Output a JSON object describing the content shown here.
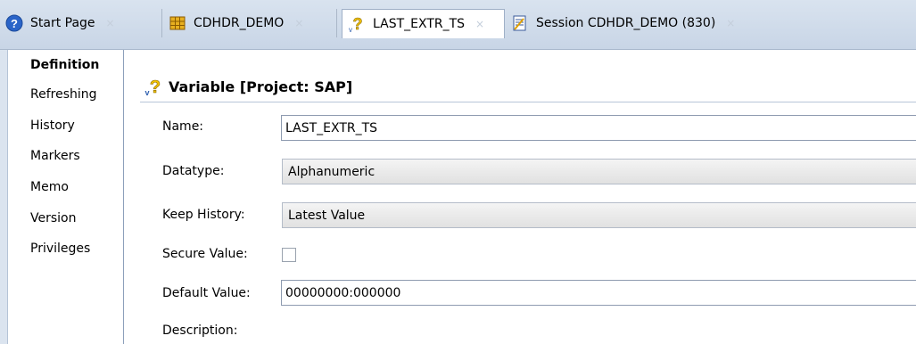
{
  "tabs": [
    {
      "label": "Start Page",
      "icon": "help-circle-icon",
      "close": "×"
    },
    {
      "label": "CDHDR_DEMO",
      "icon": "table-icon",
      "close": "×"
    },
    {
      "label": "LAST_EXTR_TS",
      "icon": "variable-icon",
      "close": "×"
    },
    {
      "label": "Session CDHDR_DEMO (830)",
      "icon": "session-icon",
      "close": "×"
    }
  ],
  "sidebar": {
    "items": [
      {
        "label": "Definition"
      },
      {
        "label": "Refreshing"
      },
      {
        "label": "History"
      },
      {
        "label": "Markers"
      },
      {
        "label": "Memo"
      },
      {
        "label": "Version"
      },
      {
        "label": "Privileges"
      }
    ]
  },
  "main": {
    "heading": "Variable [Project: SAP]",
    "fields": {
      "name": {
        "label": "Name:",
        "value": "LAST_EXTR_TS"
      },
      "datatype": {
        "label": "Datatype:",
        "value": "Alphanumeric"
      },
      "keep_history": {
        "label": "Keep History:",
        "value": "Latest Value"
      },
      "secure_value": {
        "label": "Secure Value:"
      },
      "default_value": {
        "label": "Default Value:",
        "value": "00000000:000000"
      },
      "description": {
        "label": "Description:"
      }
    }
  },
  "colors": {
    "tabbar_bg": "#c8d5e6",
    "help_icon_blue": "#2a64c8",
    "variable_icon_yellow": "#f2c200"
  }
}
